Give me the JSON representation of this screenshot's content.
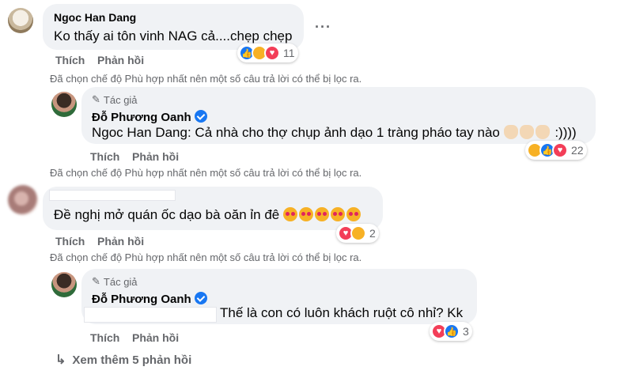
{
  "comment1": {
    "author": "Ngoc Han Dang",
    "text": "Ko thấy ai tôn vinh NAG cả....chẹp chẹp",
    "more": "···",
    "like": "Thích",
    "reply": "Phản hồi",
    "reaction_count": "11",
    "filter_note": "Đã chọn chế độ Phù hợp nhất nên một số câu trả lời có thể bị lọc ra."
  },
  "reply1": {
    "tag": "Tác giả",
    "author": "Đỗ Phương Oanh",
    "mention": "Ngoc Han Dang",
    "text": ": Cả nhà cho thợ chụp ảnh dạo 1 tràng pháo tay nào",
    "tail": ":))))",
    "like": "Thích",
    "reply": "Phản hồi",
    "reaction_count": "22",
    "filter_note": "Đã chọn chế độ Phù hợp nhất nên một số câu trả lời có thể bị lọc ra."
  },
  "comment2": {
    "text": "Đề nghị mở quán ốc dạo bà oăn ỉn đê",
    "like": "Thích",
    "reply": "Phản hồi",
    "reaction_count": "2",
    "filter_note": "Đã chọn chế độ Phù hợp nhất nên một số câu trả lời có thể bị lọc ra."
  },
  "reply2": {
    "tag": "Tác giả",
    "author": "Đỗ Phương Oanh",
    "text": "Thế là con có luôn khách ruột cô nhỉ? Kk",
    "like": "Thích",
    "reply": "Phản hồi",
    "reaction_count": "3"
  },
  "more_replies": {
    "label": "Xem thêm 5 phản hồi"
  },
  "colors": {
    "bubble": "#f0f2f5",
    "secondary_text": "#65676b",
    "like_blue": "#1877f2",
    "love_red": "#f33e58",
    "haha_yellow": "#f7b125"
  }
}
